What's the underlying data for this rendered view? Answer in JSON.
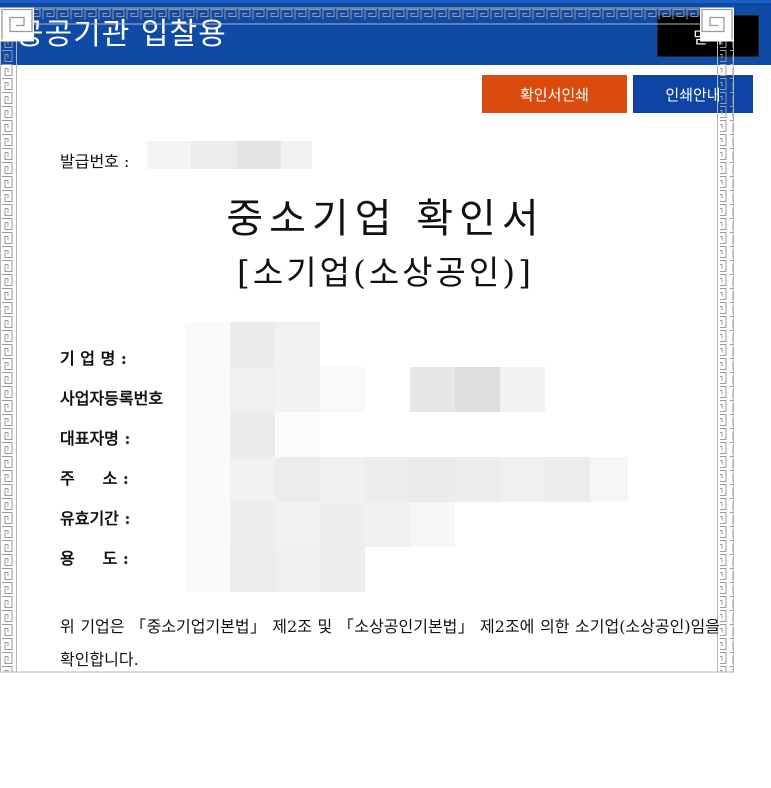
{
  "header": {
    "title": "공공기관 입찰용",
    "close_label": "닫기"
  },
  "toolbar": {
    "print_label": "확인서인쇄",
    "guide_label": "인쇄안내"
  },
  "certificate": {
    "issue_label": "발급번호 :",
    "title": "중소기업 확인서",
    "subtitle": "[소기업(소상공인)]",
    "fields": [
      {
        "label": "기 업 명 :"
      },
      {
        "label": "사업자등록번호"
      },
      {
        "label": "대표자명 :"
      },
      {
        "label": "주     소 :"
      },
      {
        "label": "유효기간 :"
      },
      {
        "label": "용     도 :"
      }
    ],
    "statement": "위 기업은 「중소기업기본법」 제2조 및 「소상공인기본법」 제2조에 의한 소기업(소상공인)임을 확인합니다."
  },
  "colors": {
    "header_bg": "#0e4aa6",
    "print_button": "#d94b0f",
    "guide_button": "#0e44a3",
    "close_button": "#000000"
  }
}
